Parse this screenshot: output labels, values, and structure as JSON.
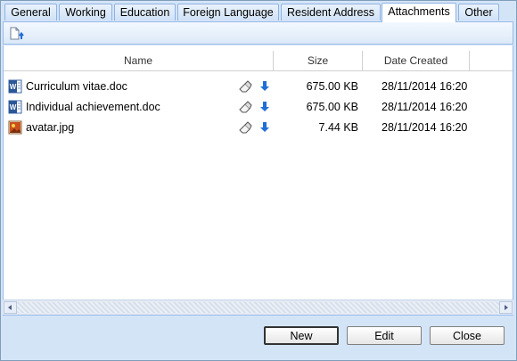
{
  "tabs": [
    {
      "label": "General",
      "active": false
    },
    {
      "label": "Working",
      "active": false
    },
    {
      "label": "Education",
      "active": false
    },
    {
      "label": "Foreign Language",
      "active": false
    },
    {
      "label": "Resident Address",
      "active": false
    },
    {
      "label": "Attachments",
      "active": true
    },
    {
      "label": "Other",
      "active": false
    }
  ],
  "toolbar": {
    "upload_icon": "upload-file-icon"
  },
  "grid": {
    "columns": {
      "name": "Name",
      "size": "Size",
      "date_created": "Date Created"
    },
    "rows": [
      {
        "icon": "word-doc-icon",
        "name": "Curriculum vitae.doc",
        "size": "675.00 KB",
        "date": "28/11/2014 16:20"
      },
      {
        "icon": "word-doc-icon",
        "name": "Individual achievement.doc",
        "size": "675.00 KB",
        "date": "28/11/2014 16:20"
      },
      {
        "icon": "image-file-icon",
        "name": "avatar.jpg",
        "size": "7.44 KB",
        "date": "28/11/2014 16:20"
      }
    ]
  },
  "buttons": {
    "new": "New",
    "edit": "Edit",
    "close": "Close"
  },
  "colors": {
    "accent": "#99bbe8",
    "background": "#d4e4f7",
    "download": "#1f6fd6"
  }
}
